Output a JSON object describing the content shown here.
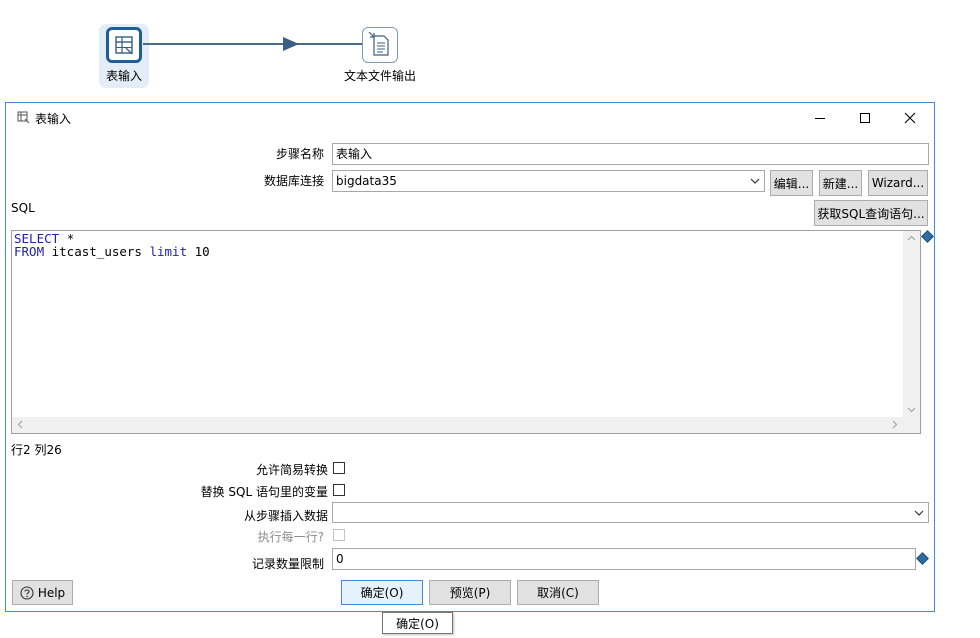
{
  "canvas": {
    "step1_label": "表输入",
    "step2_label": "文本文件输出"
  },
  "dialog": {
    "title": "表输入",
    "step_name_label": "步骤名称",
    "step_name_value": "表输入",
    "connection_label": "数据库连接",
    "connection_value": "bigdata35",
    "edit_button": "编辑...",
    "new_button": "新建...",
    "wizard_button": "Wizard...",
    "sql_label": "SQL",
    "get_sql_button": "获取SQL查询语句...",
    "sql": {
      "line1_kw": "SELECT",
      "line1_rest": " *",
      "line2_kw1": "FROM",
      "line2_mid": " itcast_users ",
      "line2_kw2": "limit",
      "line2_rest": " 10"
    },
    "cursor_position": "行2 列26",
    "allow_lazy_conversion_label": "允许简易转换",
    "replace_variables_label": "替换 SQL 语句里的变量",
    "insert_from_step_label": "从步骤插入数据",
    "insert_from_step_value": "",
    "execute_each_row_label": "执行每一行?",
    "limit_label": "记录数量限制",
    "limit_value": "0",
    "help_button": "Help",
    "ok_button": "确定(O)",
    "preview_button": "预览(P)",
    "cancel_button": "取消(C)"
  },
  "tooltip": "确定(O)",
  "colors": {
    "accent_border": "#3c8ee3",
    "step_border": "#1f5c99",
    "sql_keyword": "#2222aa"
  }
}
